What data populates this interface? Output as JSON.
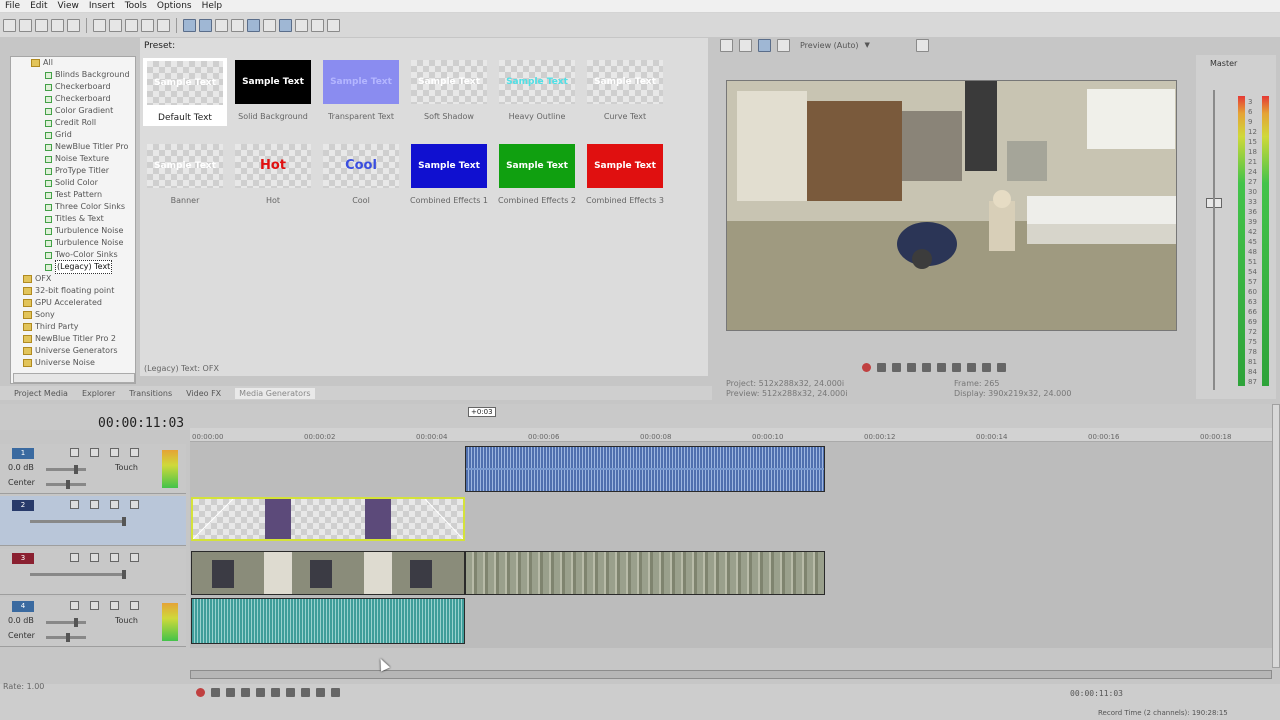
{
  "menu": [
    "File",
    "Edit",
    "View",
    "Insert",
    "Tools",
    "Options",
    "Help"
  ],
  "explorer": {
    "items": [
      {
        "label": "All",
        "type": "folder"
      },
      {
        "label": "Blinds Background",
        "type": "fx"
      },
      {
        "label": "Checkerboard",
        "type": "fx"
      },
      {
        "label": "Checkerboard",
        "type": "fx"
      },
      {
        "label": "Color Gradient",
        "type": "fx"
      },
      {
        "label": "Credit Roll",
        "type": "fx"
      },
      {
        "label": "Grid",
        "type": "fx"
      },
      {
        "label": "NewBlue Titler Pro",
        "type": "fx"
      },
      {
        "label": "Noise Texture",
        "type": "fx"
      },
      {
        "label": "ProType Titler",
        "type": "fx"
      },
      {
        "label": "Solid Color",
        "type": "fx"
      },
      {
        "label": "Test Pattern",
        "type": "fx"
      },
      {
        "label": "Three Color Sinks",
        "type": "fx"
      },
      {
        "label": "Titles & Text",
        "type": "fx"
      },
      {
        "label": "Turbulence Noise",
        "type": "fx"
      },
      {
        "label": "Turbulence Noise",
        "type": "fx"
      },
      {
        "label": "Two-Color Sinks",
        "type": "fx"
      },
      {
        "label": "(Legacy) Text",
        "type": "fx",
        "selected": true
      },
      {
        "label": "OFX",
        "type": "folder"
      },
      {
        "label": "32-bit floating point",
        "type": "folder"
      },
      {
        "label": "GPU Accelerated",
        "type": "folder"
      },
      {
        "label": "Sony",
        "type": "folder"
      },
      {
        "label": "Third Party",
        "type": "folder"
      },
      {
        "label": "NewBlue Titler Pro 2",
        "type": "folder"
      },
      {
        "label": "Universe Generators",
        "type": "folder"
      },
      {
        "label": "Universe Noise",
        "type": "folder"
      }
    ]
  },
  "presets": {
    "header": "Preset:",
    "items": [
      {
        "label": "Default Text",
        "thumb": "Sample Text",
        "style": "checker",
        "selected": true
      },
      {
        "label": "Solid Background",
        "thumb": "Sample Text",
        "style": "black"
      },
      {
        "label": "Transparent Text",
        "thumb": "Sample Text",
        "style": "purple"
      },
      {
        "label": "Soft Shadow",
        "thumb": "Sample Text",
        "style": "checker"
      },
      {
        "label": "Heavy Outline",
        "thumb": "Sample Text",
        "style": "cyan"
      },
      {
        "label": "Curve Text",
        "thumb": "Sample Text",
        "style": "checker"
      },
      {
        "label": "Banner",
        "thumb": "Sample Text",
        "style": "checker"
      },
      {
        "label": "Hot",
        "thumb": "Hot",
        "style": "hot"
      },
      {
        "label": "Cool",
        "thumb": "Cool",
        "style": "cool"
      },
      {
        "label": "Combined Effects 1",
        "thumb": "Sample Text",
        "style": "blue"
      },
      {
        "label": "Combined Effects 2",
        "thumb": "Sample Text",
        "style": "green"
      },
      {
        "label": "Combined Effects 3",
        "thumb": "Sample Text",
        "style": "red"
      }
    ],
    "status": "(Legacy) Text: OFX"
  },
  "tabs": [
    "Project Media",
    "Explorer",
    "Transitions",
    "Video FX",
    "Media Generators"
  ],
  "active_tab": "Media Generators",
  "preview": {
    "quality": "Preview (Auto)",
    "project_line": "Project: 512x288x32, 24.000i",
    "preview_line": "Preview: 512x288x32, 24.000i",
    "frame_line": "Frame: 265",
    "display_line": "Display: 390x219x32, 24.000"
  },
  "master": {
    "label": "Master",
    "scale": [
      "3",
      "6",
      "9",
      "12",
      "15",
      "18",
      "21",
      "24",
      "27",
      "30",
      "33",
      "36",
      "39",
      "42",
      "45",
      "48",
      "51",
      "54",
      "57",
      "60",
      "63",
      "66",
      "69",
      "72",
      "75",
      "78",
      "81",
      "84",
      "87"
    ]
  },
  "timeline": {
    "timecode": "00:00:11:03",
    "cursor_badge": "+0:03",
    "ruler": [
      "00:00:00",
      "00:00:02",
      "00:00:04",
      "00:00:06",
      "00:00:08",
      "00:00:10",
      "00:00:12",
      "00:00:14",
      "00:00:16",
      "00:00:18"
    ],
    "tracks": [
      {
        "num": "1",
        "type": "audio",
        "vol": "0.0 dB",
        "pan": "Center",
        "mode": "Touch"
      },
      {
        "num": "2",
        "type": "video"
      },
      {
        "num": "3",
        "type": "video"
      },
      {
        "num": "4",
        "type": "audio",
        "vol": "0.0 dB",
        "pan": "Center",
        "mode": "Touch"
      }
    ],
    "rate": "Rate: 1.00",
    "end_timecode": "00:00:11:03",
    "record_time": "Record Time (2 channels): 190:28:15"
  }
}
